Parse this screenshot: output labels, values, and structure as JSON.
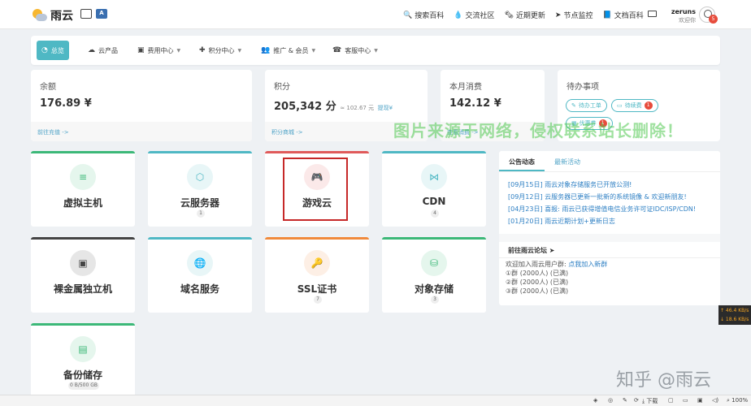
{
  "brand": {
    "name": "雨云"
  },
  "topnav": [
    {
      "icon": "search-icon",
      "glyph": "🔍",
      "label": "搜索百科"
    },
    {
      "icon": "chat-icon",
      "glyph": "💧",
      "label": "交流社区"
    },
    {
      "icon": "news-icon",
      "glyph": "🗞",
      "label": "近期更新"
    },
    {
      "icon": "send-icon",
      "glyph": "➤",
      "label": "节点监控"
    },
    {
      "icon": "book-icon",
      "glyph": "📘",
      "label": "文档百科"
    }
  ],
  "user": {
    "name": "zeruns",
    "greeting": "欢迎你",
    "notifications": "5"
  },
  "menu": [
    {
      "icon": "dashboard-icon",
      "glyph": "◔",
      "label": "总览",
      "active": true
    },
    {
      "icon": "cloud-icon",
      "glyph": "☁",
      "label": "云产品"
    },
    {
      "icon": "card-icon",
      "glyph": "▣",
      "label": "费用中心",
      "dropdown": true
    },
    {
      "icon": "gift-icon",
      "glyph": "✚",
      "label": "积分中心",
      "dropdown": true
    },
    {
      "icon": "users-icon",
      "glyph": "👥",
      "label": "推广 & 会员",
      "dropdown": true
    },
    {
      "icon": "headset-icon",
      "glyph": "☎",
      "label": "客服中心",
      "dropdown": true
    }
  ],
  "stats": {
    "balance": {
      "label": "余额",
      "value": "176.89 ¥",
      "link": "前往充值 ->"
    },
    "points": {
      "label": "积分",
      "value": "205,342 分",
      "approx": "≈ 102.67 元",
      "withdraw": "提现¥",
      "link": "积分商城 ->"
    },
    "spend": {
      "label": "本月消费",
      "value": "142.12 ¥",
      "link": "查看消费 ->"
    },
    "todo": {
      "label": "待办事项",
      "buttons": [
        {
          "label": "待办工单",
          "count": ""
        },
        {
          "label": "待续费",
          "count": "1"
        },
        {
          "label": "优惠券",
          "count": "1"
        }
      ]
    }
  },
  "services": [
    {
      "name": "虚拟主机",
      "count": "",
      "color": "#3cb878",
      "icon": "server-icon",
      "glyph": "≡"
    },
    {
      "name": "云服务器",
      "count": "1",
      "color": "#4fb8c4",
      "icon": "cube-icon",
      "glyph": "⬡"
    },
    {
      "name": "游戏云",
      "count": "",
      "color": "#e05a5a",
      "icon": "gamepad-icon",
      "glyph": "🎮"
    },
    {
      "name": "CDN",
      "count": "4",
      "color": "#4fb8c4",
      "icon": "cdn-icon",
      "glyph": "⋈"
    },
    {
      "name": "裸金属独立机",
      "count": "",
      "color": "#444444",
      "icon": "metal-icon",
      "glyph": "▣"
    },
    {
      "name": "域名服务",
      "count": "",
      "color": "#4fb8c4",
      "icon": "globe-icon",
      "glyph": "🌐"
    },
    {
      "name": "SSL证书",
      "count": "7",
      "color": "#f08a3c",
      "icon": "key-icon",
      "glyph": "🔑"
    },
    {
      "name": "对象存储",
      "count": "3",
      "color": "#3cb878",
      "icon": "database-icon",
      "glyph": "⛁"
    },
    {
      "name": "备份储存",
      "count": "0 B/500 GB",
      "color": "#3cb878",
      "icon": "archive-icon",
      "glyph": "▤"
    }
  ],
  "news": {
    "tabs": [
      "公告动态",
      "最新活动"
    ],
    "items": [
      "[09月15日] 雨云对象存储服务已开放公测!",
      "[09月12日] 云服务器已更新一批新的系统镜像 & 欢迎新朋友!",
      "[04月23日] 喜报: 雨云已获得增值电信业务许可证IDC/ISP/CDN!",
      "[01月20日] 雨云近期计划+更新日志"
    ],
    "forum_title": "前往雨云论坛",
    "forum_intro": "欢迎加入雨云用户群:",
    "forum_link": "点我加入新群",
    "groups": [
      "①群 (2000人) (已满)",
      "②群 (2000人) (已满)",
      "③群 (2000人) (已满)"
    ]
  },
  "watermark": "图片来源于网络，侵权联系站长删除！",
  "zhihu_mark": "知乎 @雨云",
  "speed": {
    "up": "↑ 46.4 KB/s",
    "down": "↓ 18.6 KB/s"
  },
  "taskbar": {
    "download": "下载",
    "zoom": "100%"
  }
}
